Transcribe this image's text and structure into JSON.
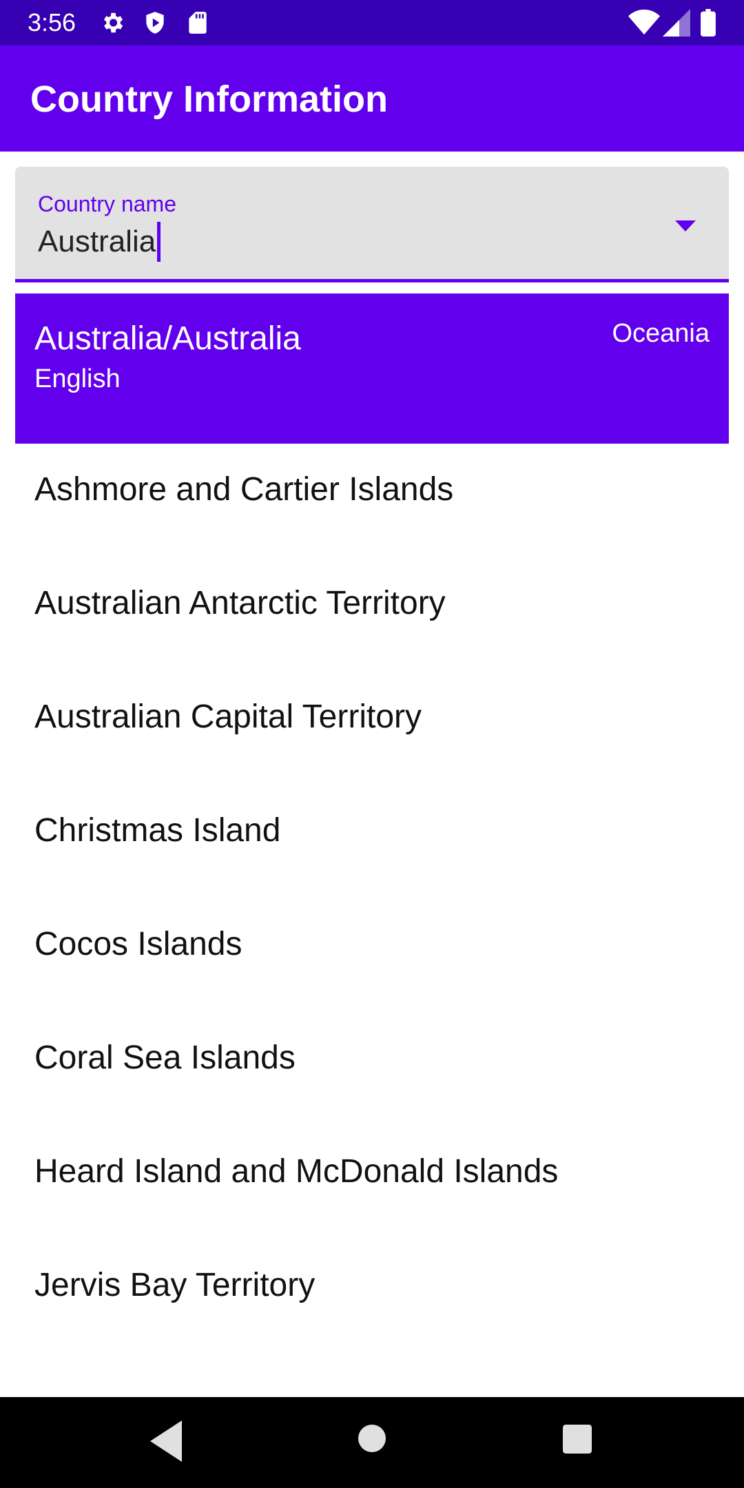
{
  "status_bar": {
    "time": "3:56",
    "left_icons": [
      "gear-icon",
      "shield-icon",
      "sd-card-icon"
    ],
    "right_icons": [
      "wifi-icon",
      "cell-signal-icon",
      "battery-icon"
    ]
  },
  "app_bar": {
    "title": "Country Information"
  },
  "search": {
    "label": "Country name",
    "value": "Australia",
    "dropdown_icon": "dropdown-arrow-icon"
  },
  "selected": {
    "title": "Australia/Australia",
    "language": "English",
    "region": "Oceania"
  },
  "list": {
    "items": [
      "Ashmore and Cartier Islands",
      "Australian Antarctic Territory",
      "Australian Capital Territory",
      "Christmas Island",
      "Cocos Islands",
      "Coral Sea Islands",
      "Heard Island and McDonald Islands",
      "Jervis Bay Territory"
    ]
  },
  "nav_bar": {
    "buttons": [
      "back-icon",
      "home-icon",
      "recents-icon"
    ]
  },
  "colors": {
    "primary": "#6200ee",
    "primary_dark": "#3700b3",
    "field_bg": "#e2e2e2"
  }
}
